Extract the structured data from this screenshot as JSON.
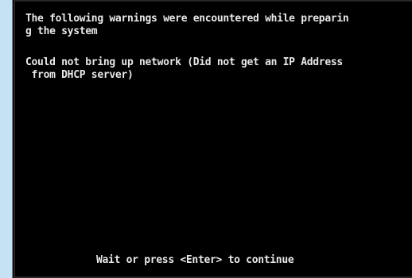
{
  "console": {
    "warning_header": [
      "The following warnings were encountered while preparin",
      "g the system"
    ],
    "warnings": [
      "Could not bring up network (Did not get an IP Address",
      " from DHCP server)"
    ],
    "prompt": "Wait or press <Enter> to continue"
  },
  "colors": {
    "page_background": "#c5e2f4",
    "console_background": "#000000",
    "console_text": "#e8e8e8"
  }
}
